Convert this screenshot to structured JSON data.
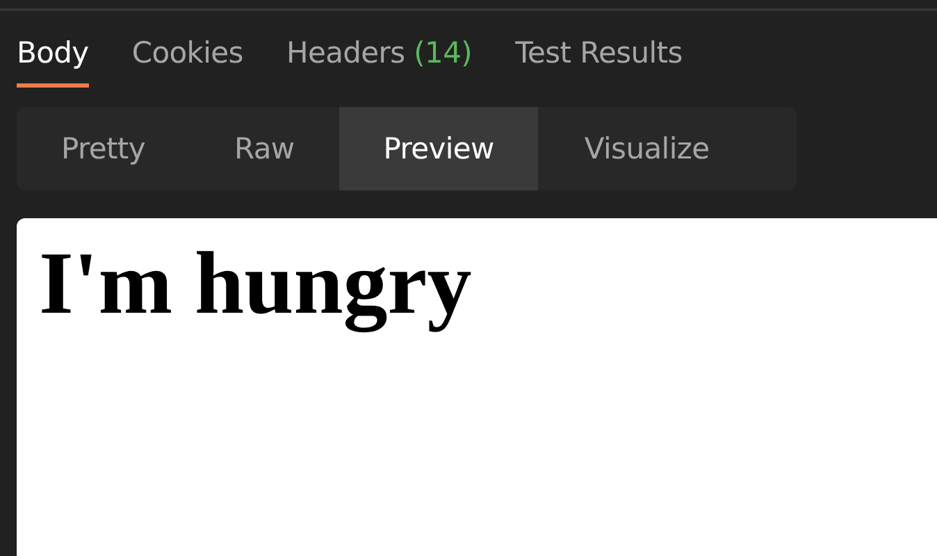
{
  "tabs": [
    {
      "label": "Body",
      "selected": true
    },
    {
      "label": "Cookies",
      "selected": false
    },
    {
      "label": "Headers",
      "count": "(14)",
      "selected": false
    },
    {
      "label": "Test Results",
      "selected": false
    }
  ],
  "view_modes": [
    {
      "label": "Pretty",
      "selected": false
    },
    {
      "label": "Raw",
      "selected": false
    },
    {
      "label": "Preview",
      "selected": true
    },
    {
      "label": "Visualize",
      "selected": false
    }
  ],
  "preview": {
    "heading": "I'm hungry"
  }
}
